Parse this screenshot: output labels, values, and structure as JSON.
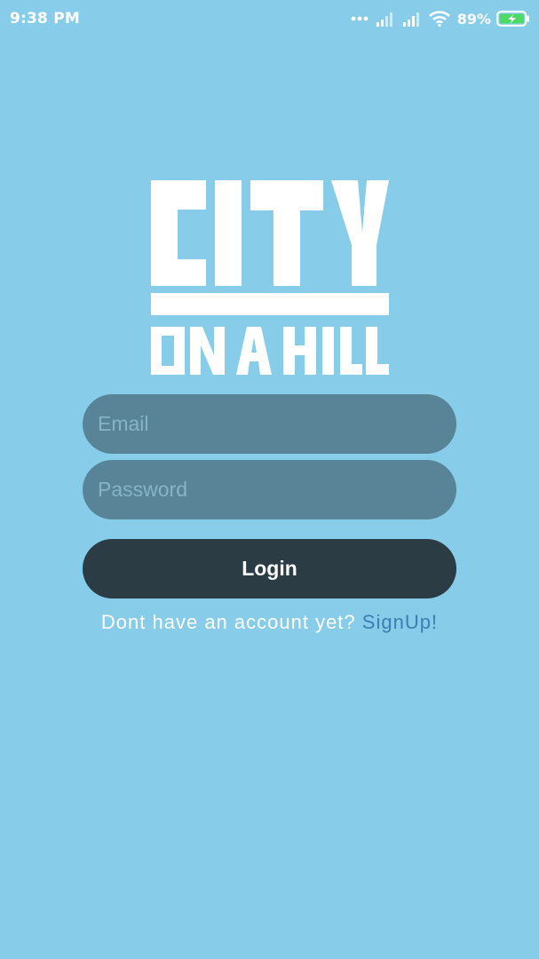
{
  "status_bar": {
    "time": "9:38 PM",
    "battery_percent": "89%",
    "icons": [
      "dots-icon",
      "signal-icon",
      "signal-icon",
      "wifi-icon",
      "battery-charging-icon"
    ]
  },
  "logo": {
    "line1": "CITY",
    "line2": "ON A HILL"
  },
  "login_form": {
    "email_placeholder": "Email",
    "email_value": "",
    "password_placeholder": "Password",
    "password_value": "",
    "login_label": "Login"
  },
  "signup": {
    "prompt": "Dont have an account yet?",
    "link_label": "SignUp!"
  },
  "colors": {
    "background": "#87cdea",
    "field": "#598497",
    "button": "#2c3c45",
    "link": "#3a7fb1",
    "battery_bolt": "#4cd964"
  }
}
